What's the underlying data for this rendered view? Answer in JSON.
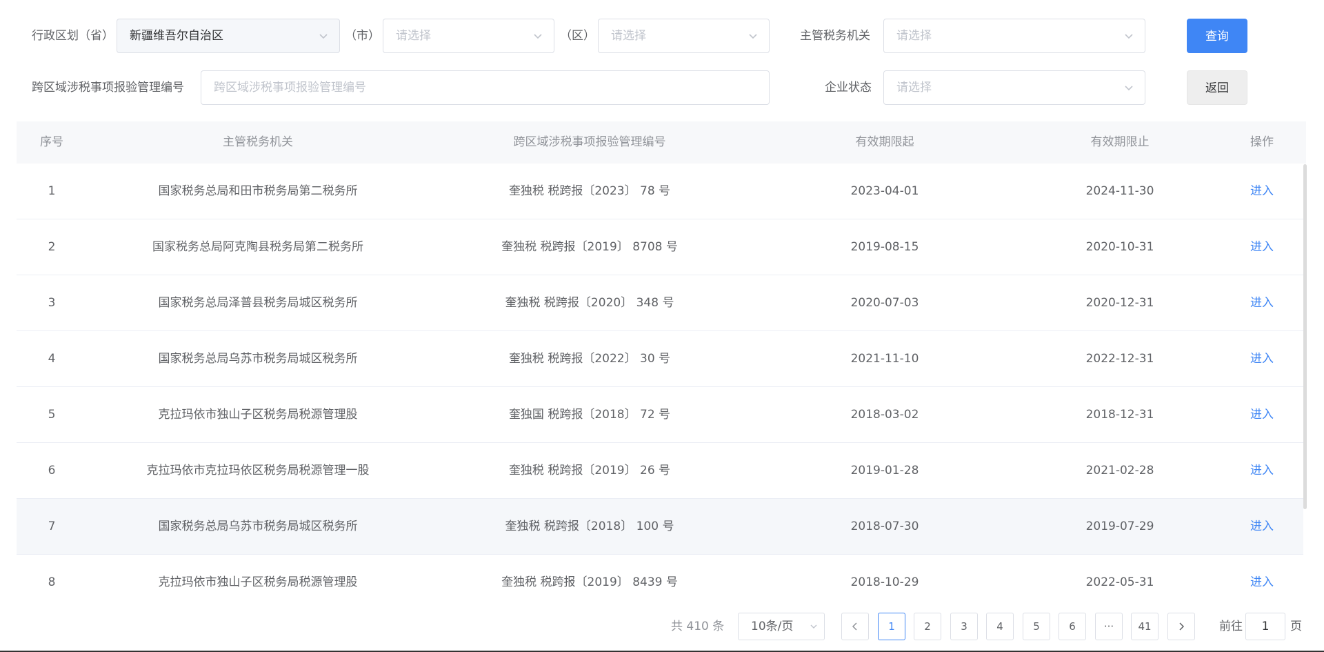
{
  "filters": {
    "province_label": "行政区划（省）",
    "province_value": "新疆维吾尔自治区",
    "city_label": "（市）",
    "city_placeholder": "请选择",
    "district_label": "（区）",
    "district_placeholder": "请选择",
    "tax_office_label": "主管税务机关",
    "tax_office_placeholder": "请选择",
    "query_button": "查询",
    "report_no_label": "跨区域涉税事项报验管理编号",
    "report_no_placeholder": "跨区域涉税事项报验管理编号",
    "company_status_label": "企业状态",
    "company_status_placeholder": "请选择",
    "back_button": "返回"
  },
  "table": {
    "columns": [
      "序号",
      "主管税务机关",
      "跨区域涉税事项报验管理编号",
      "有效期限起",
      "有效期限止",
      "操作"
    ],
    "rows": [
      {
        "idx": "1",
        "org": "国家税务总局和田市税务局第二税务所",
        "no": "奎独税 税跨报〔2023〕 78 号",
        "from": "2023-04-01",
        "to": "2024-11-30",
        "op": "进入"
      },
      {
        "idx": "2",
        "org": "国家税务总局阿克陶县税务局第二税务所",
        "no": "奎独税 税跨报〔2019〕 8708 号",
        "from": "2019-08-15",
        "to": "2020-10-31",
        "op": "进入"
      },
      {
        "idx": "3",
        "org": "国家税务总局泽普县税务局城区税务所",
        "no": "奎独税 税跨报〔2020〕 348 号",
        "from": "2020-07-03",
        "to": "2020-12-31",
        "op": "进入"
      },
      {
        "idx": "4",
        "org": "国家税务总局乌苏市税务局城区税务所",
        "no": "奎独税 税跨报〔2022〕 30 号",
        "from": "2021-11-10",
        "to": "2022-12-31",
        "op": "进入"
      },
      {
        "idx": "5",
        "org": "克拉玛依市独山子区税务局税源管理股",
        "no": "奎独国 税跨报〔2018〕 72 号",
        "from": "2018-03-02",
        "to": "2018-12-31",
        "op": "进入"
      },
      {
        "idx": "6",
        "org": "克拉玛依市克拉玛依区税务局税源管理一股",
        "no": "奎独税 税跨报〔2019〕 26 号",
        "from": "2019-01-28",
        "to": "2021-02-28",
        "op": "进入"
      },
      {
        "idx": "7",
        "org": "国家税务总局乌苏市税务局城区税务所",
        "no": "奎独税 税跨报〔2018〕 100 号",
        "from": "2018-07-30",
        "to": "2019-07-29",
        "op": "进入"
      },
      {
        "idx": "8",
        "org": "克拉玛依市独山子区税务局税源管理股",
        "no": "奎独税 税跨报〔2019〕 8439 号",
        "from": "2018-10-29",
        "to": "2022-05-31",
        "op": "进入"
      }
    ]
  },
  "pagination": {
    "total": "共 410 条",
    "page_size": "10条/页",
    "pages": [
      "1",
      "2",
      "3",
      "4",
      "5",
      "6"
    ],
    "ellipsis": "···",
    "last_page": "41",
    "goto_prefix": "前往",
    "goto_value": "1",
    "goto_suffix": "页",
    "current_page": "1"
  },
  "colors": {
    "primary": "#3f86f5",
    "header_bg": "#f7f8fa",
    "border": "#dcdfe6"
  },
  "icons": {
    "select_arrow": "chevron-down-icon",
    "prev": "chevron-left-icon",
    "next": "chevron-right-icon"
  }
}
